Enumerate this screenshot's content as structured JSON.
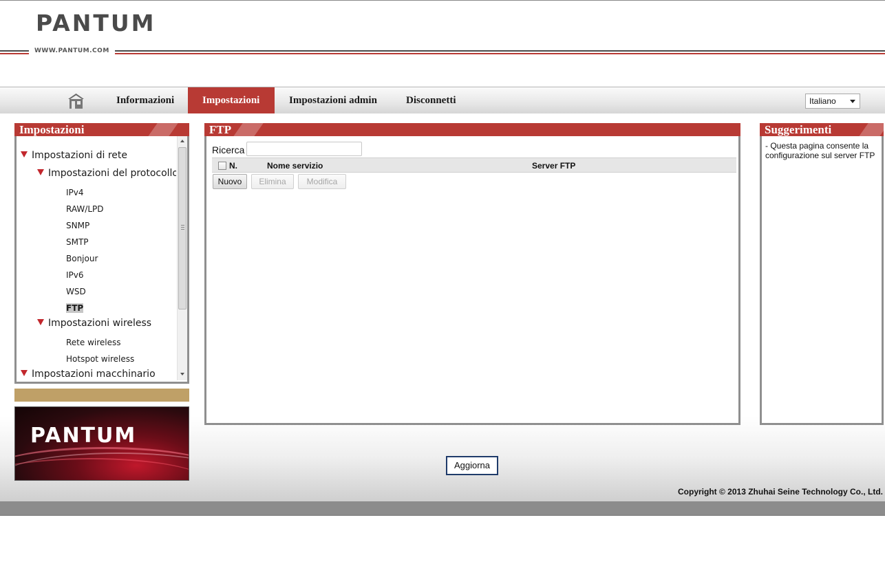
{
  "brand": {
    "logo": "PANTUM",
    "url": "WWW.PANTUM.COM"
  },
  "nav": {
    "home_icon": "home-icon",
    "items": [
      {
        "label": "Informazioni",
        "active": false
      },
      {
        "label": "Impostazioni",
        "active": true
      },
      {
        "label": "Impostazioni admin",
        "active": false
      },
      {
        "label": "Disconnetti",
        "active": false
      }
    ],
    "language": "Italiano"
  },
  "sidebar": {
    "title": "Impostazioni",
    "tree": {
      "network": "Impostazioni di rete",
      "protocol": "Impostazioni del protocollo",
      "protocol_items": [
        "IPv4",
        "RAW/LPD",
        "SNMP",
        "SMTP",
        "Bonjour",
        "IPv6",
        "WSD",
        "FTP"
      ],
      "selected": "FTP",
      "wireless": "Impostazioni wireless",
      "wireless_items": [
        "Rete wireless",
        "Hotspot wireless"
      ],
      "machine": "Impostazioni macchinario"
    },
    "banner_logo": "PANTUM"
  },
  "main": {
    "title": "FTP",
    "search_label": "Ricerca",
    "search_value": "",
    "columns": {
      "number": "N.",
      "service_name": "Nome servizio",
      "ftp_server": "Server FTP"
    },
    "rows": [],
    "buttons": {
      "new": "Nuovo",
      "delete": "Elimina",
      "edit": "Modifica"
    }
  },
  "hints": {
    "title": "Suggerimenti",
    "text": "- Questa pagina consente la configurazione sul server FTP"
  },
  "refresh_label": "Aggiorna",
  "copyright": "Copyright © 2013 Zhuhai Seine Technology Co., Ltd.",
  "colors": {
    "accent": "#b83a34",
    "gold": "#bfa067",
    "border": "#8f8f8f"
  }
}
